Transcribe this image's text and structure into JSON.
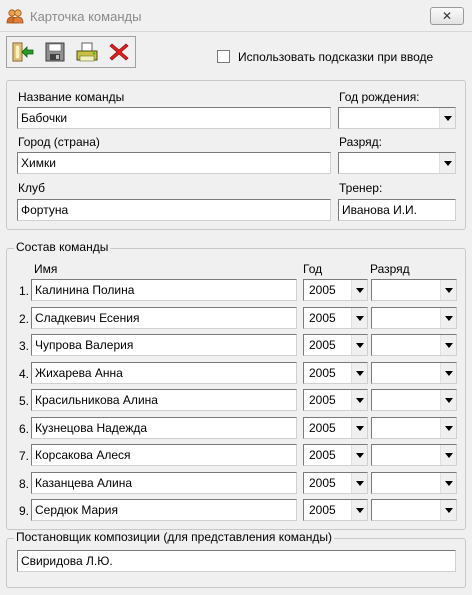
{
  "window": {
    "title": "Карточка команды",
    "close_glyph": "✕"
  },
  "toolbar": {
    "buttons": [
      {
        "name": "exit-icon"
      },
      {
        "name": "floppy-save-icon"
      },
      {
        "name": "print-icon"
      },
      {
        "name": "delete-icon"
      }
    ]
  },
  "hints": {
    "label": "Использовать подсказки при вводе",
    "checked": false
  },
  "team": {
    "name_label": "Название команды",
    "name_value": "Бабочки",
    "birth_label": "Год рождения:",
    "birth_value": "",
    "city_label": "Город (страна)",
    "city_value": "Химки",
    "rank_label": "Разряд:",
    "rank_value": "",
    "club_label": "Клуб",
    "club_value": "Фортуна",
    "coach_label": "Тренер:",
    "coach_value": "Иванова И.И."
  },
  "roster": {
    "title": "Состав команды",
    "col_name": "Имя",
    "col_year": "Год",
    "col_rank": "Разряд",
    "members": [
      {
        "num": "1.",
        "name": "Калинина Полина",
        "year": "2005",
        "rank": ""
      },
      {
        "num": "2.",
        "name": "Сладкевич Есения",
        "year": "2005",
        "rank": ""
      },
      {
        "num": "3.",
        "name": "Чупрова Валерия",
        "year": "2005",
        "rank": ""
      },
      {
        "num": "4.",
        "name": "Жихарева Анна",
        "year": "2005",
        "rank": ""
      },
      {
        "num": "5.",
        "name": "Красильникова Алина",
        "year": "2005",
        "rank": ""
      },
      {
        "num": "6.",
        "name": "Кузнецова Надежда",
        "year": "2005",
        "rank": ""
      },
      {
        "num": "7.",
        "name": "Корсакова Алеся",
        "year": "2005",
        "rank": ""
      },
      {
        "num": "8.",
        "name": "Казанцева Алина",
        "year": "2005",
        "rank": ""
      },
      {
        "num": "9.",
        "name": "Сердюк Мария",
        "year": "2005",
        "rank": ""
      }
    ]
  },
  "choreographer": {
    "title": "Постановщик композиции (для представления команды)",
    "value": "Свиридова Л.Ю."
  }
}
